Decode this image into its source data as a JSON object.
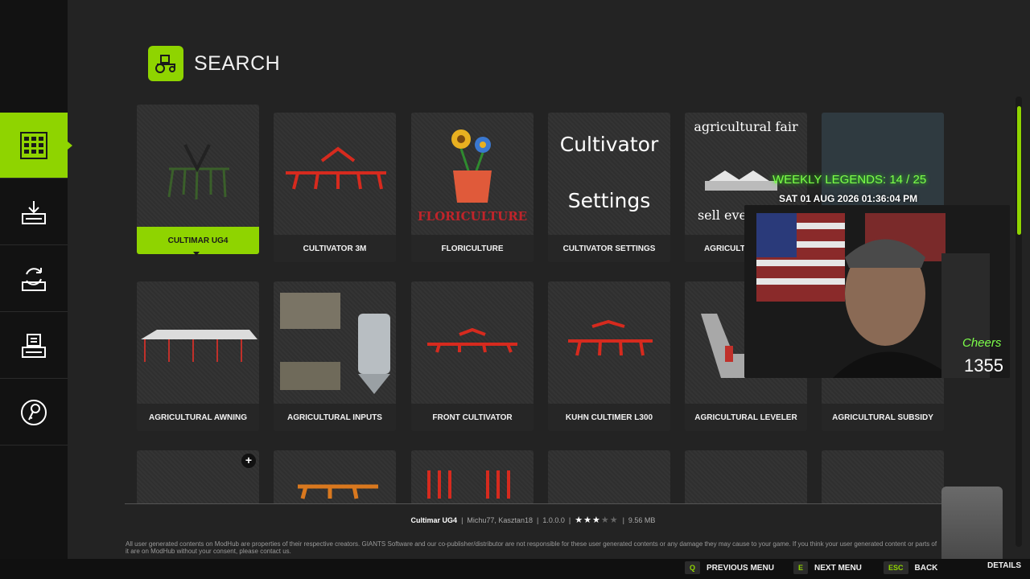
{
  "header": {
    "title": "SEARCH",
    "icon": "tractor-icon"
  },
  "sidebar": {
    "items": [
      {
        "name": "sidebar-item-browse",
        "icon": "grid-icon",
        "active": true
      },
      {
        "name": "sidebar-item-downloads",
        "icon": "download-icon",
        "active": false
      },
      {
        "name": "sidebar-item-updates",
        "icon": "update-icon",
        "active": false
      },
      {
        "name": "sidebar-item-installed",
        "icon": "installed-icon",
        "active": false
      },
      {
        "name": "sidebar-item-unlock",
        "icon": "key-icon",
        "active": false
      }
    ]
  },
  "mods": {
    "row1": [
      {
        "label": "CULTIMAR UG4",
        "selected": true
      },
      {
        "label": "CULTIVATOR 3M"
      },
      {
        "label": "FLORICULTURE",
        "thumb_text": "FLORICULTURE"
      },
      {
        "label": "CULTIVATOR SETTINGS",
        "thumb_line1": "Cultivator",
        "thumb_line2": "Settings"
      },
      {
        "label": "AGRICULTURAL FAIR",
        "thumb_line1": "agricultural fair",
        "thumb_line2": "sell everything"
      },
      {
        "label": ""
      }
    ],
    "row2": [
      {
        "label": "AGRICULTURAL AWNING"
      },
      {
        "label": "AGRICULTURAL INPUTS"
      },
      {
        "label": "FRONT CULTIVATOR"
      },
      {
        "label": "KUHN CULTIMER L300"
      },
      {
        "label": "AGRICULTURAL LEVELER"
      },
      {
        "label": "AGRICULTURAL SUBSIDY"
      }
    ],
    "row3_plus": "+"
  },
  "info": {
    "mod_name": "Cultimar UG4",
    "authors": "Michu77, Kasztan18",
    "version": "1.0.0.0",
    "rating": 3,
    "rating_max": 5,
    "size": "9.56 MB",
    "separator": "|"
  },
  "disclaimer": "All user generated contents on ModHub are properties of their respective creators. GIANTS Software and our co-publisher/distributor are not responsible for these user generated contents or any damage they may cause to your game. If you think your user generated content or parts of it are on ModHub without your consent, please contact us.",
  "hints": [
    {
      "key": "Q",
      "label": "PREVIOUS MENU"
    },
    {
      "key": "E",
      "label": "NEXT MENU"
    },
    {
      "key": "ESC",
      "label": "BACK"
    },
    {
      "key": "",
      "label": "DETAILS"
    }
  ],
  "overlay": {
    "weekly": "WEEKLY LEGENDS: 14 / 25",
    "date": "SAT 01 AUG 2026 01:36:04 PM",
    "cheers_label": "Cheers",
    "cheers_count": "1355"
  },
  "colors": {
    "accent": "#8fd400",
    "background": "#232323",
    "sidebar": "#121212"
  }
}
